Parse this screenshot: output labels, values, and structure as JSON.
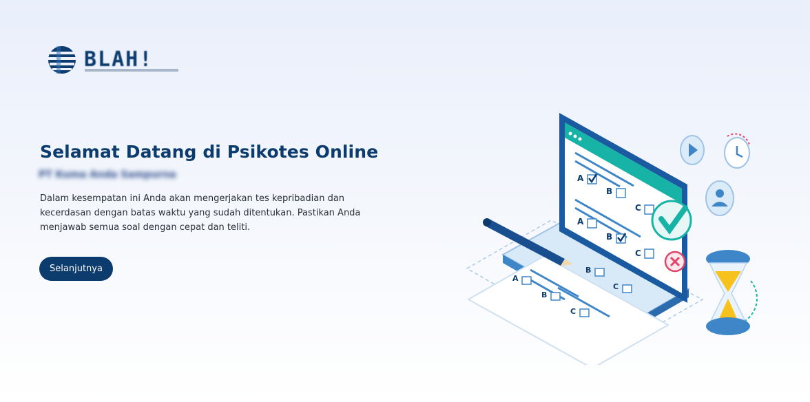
{
  "brand": {
    "name": "BLAH!"
  },
  "welcome": {
    "title": "Selamat Datang di Psikotes Online",
    "subtitle": "PT Kuma Anda Sampurna",
    "description": "Dalam kesempatan ini Anda akan mengerjakan tes kepribadian dan kecerdasan dengan batas waktu yang sudah ditentukan. Pastikan Anda menjawab semua soal dengan cepat dan teliti.",
    "next_button": "Selanjutnya"
  },
  "illustration": {
    "option_labels": [
      "A",
      "B",
      "C"
    ]
  },
  "colors": {
    "primary": "#0c3b6e",
    "accent_teal": "#16b3a6",
    "accent_red": "#e0456a",
    "accent_yellow": "#f6c21b",
    "light_blue": "#cfe3f6"
  }
}
